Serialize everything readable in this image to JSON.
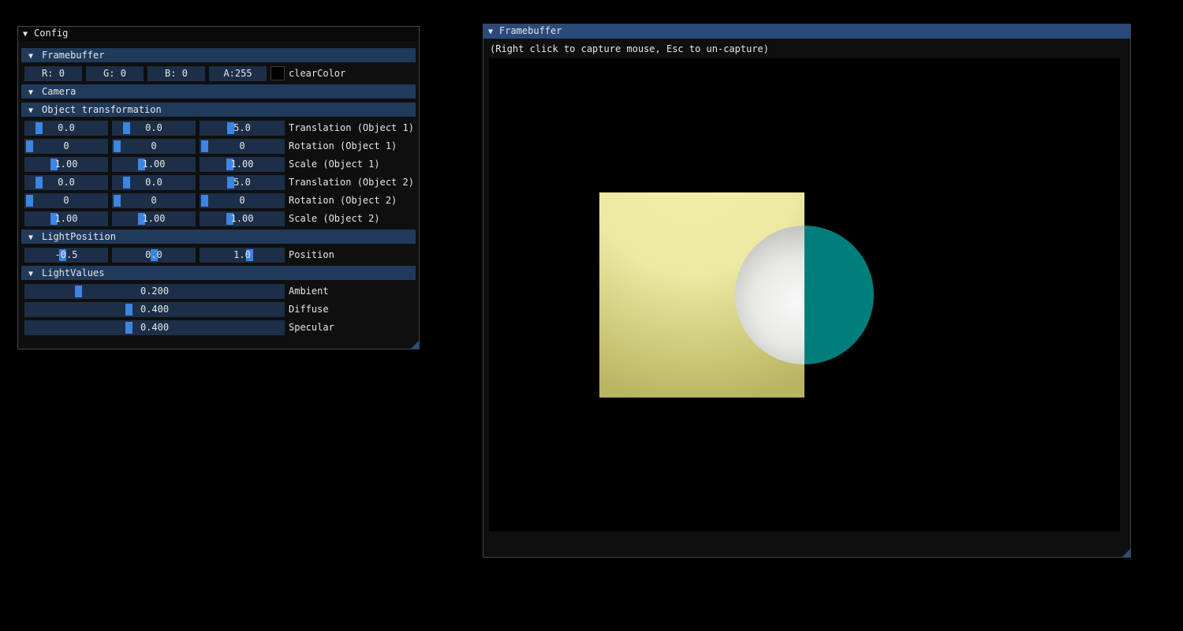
{
  "config": {
    "title": "Config",
    "sections": {
      "framebuffer": "Framebuffer",
      "camera": "Camera",
      "object_transformation": "Object transformation",
      "light_position": "LightPosition",
      "light_values": "LightValues"
    },
    "clear_color": {
      "r": "R:  0",
      "g": "G:  0",
      "b": "B:  0",
      "a": "A:255",
      "label": "clearColor",
      "swatch_color": "#000000"
    },
    "object_rows": [
      {
        "label": "Translation (Object 1)",
        "values": [
          "0.0",
          "0.0",
          "5.0"
        ]
      },
      {
        "label": "Rotation (Object 1)",
        "values": [
          "0",
          "0",
          "0"
        ]
      },
      {
        "label": "Scale (Object 1)",
        "values": [
          "1.00",
          "1.00",
          "1.00"
        ]
      },
      {
        "label": "Translation (Object 2)",
        "values": [
          "0.0",
          "0.0",
          "5.0"
        ]
      },
      {
        "label": "Rotation (Object 2)",
        "values": [
          "0",
          "0",
          "0"
        ]
      },
      {
        "label": "Scale (Object 2)",
        "values": [
          "1.00",
          "1.00",
          "1.00"
        ]
      }
    ],
    "light_position": {
      "label": "Position",
      "values": [
        "-0.5",
        "0.0",
        "1.0"
      ]
    },
    "light_values": [
      {
        "label": "Ambient",
        "value": "0.200",
        "fraction": 0.2
      },
      {
        "label": "Diffuse",
        "value": "0.400",
        "fraction": 0.4
      },
      {
        "label": "Specular",
        "value": "0.400",
        "fraction": 0.4
      }
    ]
  },
  "framebuffer_window": {
    "title": "Framebuffer",
    "hint": "(Right click to capture mouse, Esc to un-capture)"
  },
  "colors": {
    "accent": "#3d85e0",
    "header": "#203a5c",
    "active_title": "#294a7a",
    "plane_light": "#f0eea8",
    "plane_dark": "#b8b460",
    "sphere_teal": "#007e7c"
  }
}
